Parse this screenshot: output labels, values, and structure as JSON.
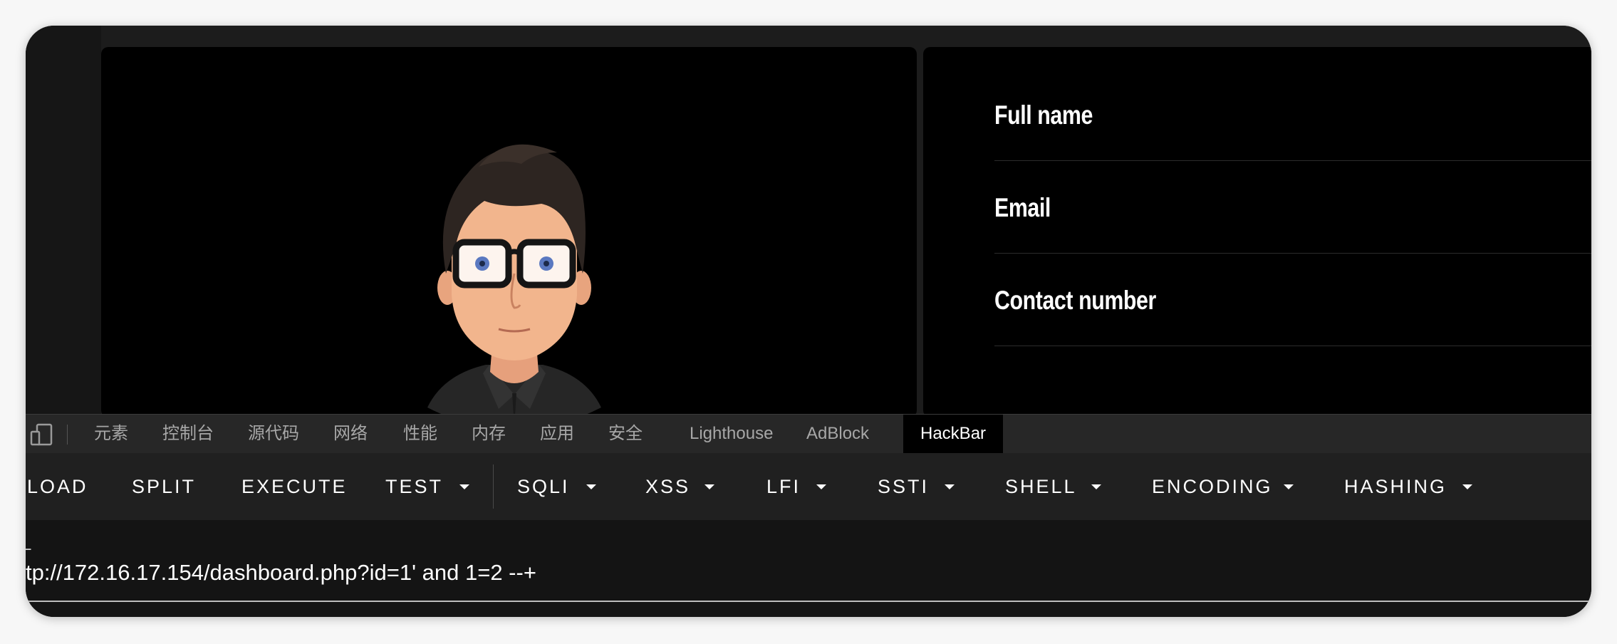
{
  "profile": {
    "fields": [
      "Full name",
      "Email",
      "Contact number"
    ]
  },
  "devtools": {
    "tabs": [
      "元素",
      "控制台",
      "源代码",
      "网络",
      "性能",
      "内存",
      "应用",
      "安全",
      "Lighthouse",
      "AdBlock",
      "HackBar"
    ],
    "active_tab": "HackBar"
  },
  "hackbar": {
    "buttons": [
      "LOAD",
      "SPLIT",
      "EXECUTE",
      "TEST",
      "SQLI",
      "XSS",
      "LFI",
      "SSTI",
      "SHELL",
      "ENCODING",
      "HASHING"
    ],
    "url_label": "L",
    "url": "tp://172.16.17.154/dashboard.php?id=1' and 1=2 --+"
  },
  "colors": {
    "background": "#000000",
    "text": "#ffffff",
    "muted_text": "#a7a7a7"
  }
}
